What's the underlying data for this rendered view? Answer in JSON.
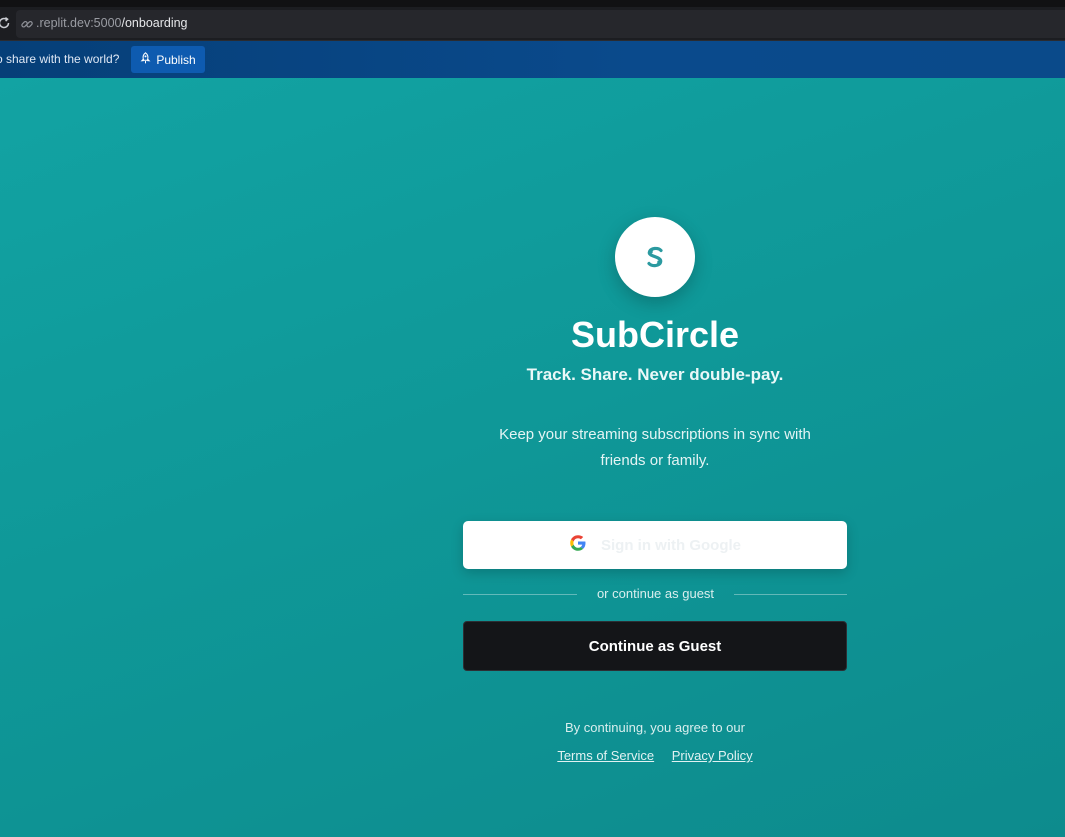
{
  "browser": {
    "url_host": ".replit.dev:5000",
    "url_path": "/onboarding"
  },
  "publish_bar": {
    "question": "o share with the world?",
    "publish_label": "Publish"
  },
  "app": {
    "logo_letter": "S",
    "title": "SubCircle",
    "tagline": "Track. Share. Never double-pay.",
    "description": "Keep your streaming subscriptions in sync with friends or family."
  },
  "auth": {
    "google_label": "Sign in with Google",
    "divider_text": "or continue as guest",
    "guest_label": "Continue as Guest"
  },
  "legal": {
    "agree_text": "By continuing, you agree to our",
    "terms_label": "Terms of Service",
    "privacy_label": "Privacy Policy"
  },
  "colors": {
    "accent": "#0f9898",
    "logo_color": "#2b9aa0",
    "guest_button": "#141518"
  },
  "icons": [
    "reload-icon",
    "link-icon",
    "rocket-icon",
    "google-icon"
  ]
}
